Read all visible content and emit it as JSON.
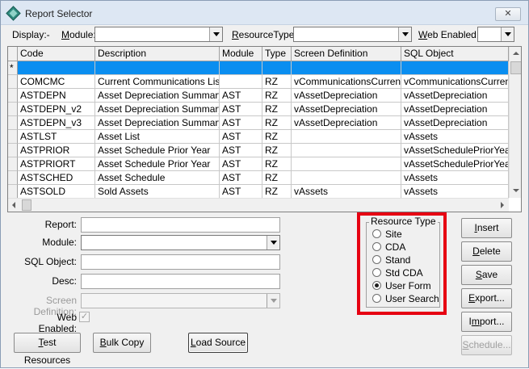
{
  "window": {
    "title": "Report Selector",
    "close_icon": "close-icon"
  },
  "filters": {
    "display_label": "Display:-",
    "module_label": "Module:",
    "module_value": "",
    "resource_type_label": "ResourceType:",
    "resource_type_value": "",
    "web_enabled_label": "Web Enabled:",
    "web_enabled_value": ""
  },
  "grid": {
    "columns": [
      "Code",
      "Description",
      "Module",
      "Type",
      "Screen Definition",
      "SQL Object"
    ],
    "new_row_marker": "*",
    "rows": [
      [
        "COMCMC",
        "Current Communications List",
        "",
        "RZ",
        "vCommunicationsCurrent",
        "vCommunicationsCurrent"
      ],
      [
        "ASTDEPN",
        "Asset Depreciation Summary",
        "AST",
        "RZ",
        "vAssetDepreciation",
        "vAssetDepreciation"
      ],
      [
        "ASTDEPN_v2",
        "Asset Depreciation Summary",
        "AST",
        "RZ",
        "vAssetDepreciation",
        "vAssetDepreciation"
      ],
      [
        "ASTDEPN_v3",
        "Asset Depreciation Summary",
        "AST",
        "RZ",
        "vAssetDepreciation",
        "vAssetDepreciation"
      ],
      [
        "ASTLST",
        "Asset List",
        "AST",
        "RZ",
        "",
        "vAssets"
      ],
      [
        "ASTPRIOR",
        "Asset Schedule Prior Year",
        "AST",
        "RZ",
        "",
        "vAssetSchedulePriorYear"
      ],
      [
        "ASTPRIORT",
        "Asset Schedule Prior Year",
        "AST",
        "RZ",
        "",
        "vAssetSchedulePriorYear"
      ],
      [
        "ASTSCHED",
        "Asset Schedule",
        "AST",
        "RZ",
        "",
        "vAssets"
      ],
      [
        "ASTSOLD",
        "Sold Assets",
        "AST",
        "RZ",
        "vAssets",
        "vAssets"
      ]
    ]
  },
  "form": {
    "report_label": "Report:",
    "module_label": "Module:",
    "sql_object_label": "SQL Object:",
    "desc_label": "Desc:",
    "screen_definition_label": "Screen Definition:",
    "web_enabled_label": "Web Enabled:"
  },
  "resource_type": {
    "title": "Resource Type",
    "options": [
      "Site",
      "CDA",
      "Stand",
      "Std CDA",
      "User Form",
      "User Search"
    ],
    "selected": "User Form"
  },
  "buttons": {
    "test_resources": "Test Resources",
    "bulk_copy": "Bulk Copy",
    "load_source": "Load Source",
    "insert": "Insert",
    "delete": "Delete",
    "save": "Save",
    "export": "Export...",
    "import": "Import...",
    "schedule": "Schedule..."
  },
  "colors": {
    "highlight_border": "#e60012",
    "selection_row": "#0a8ef0"
  }
}
